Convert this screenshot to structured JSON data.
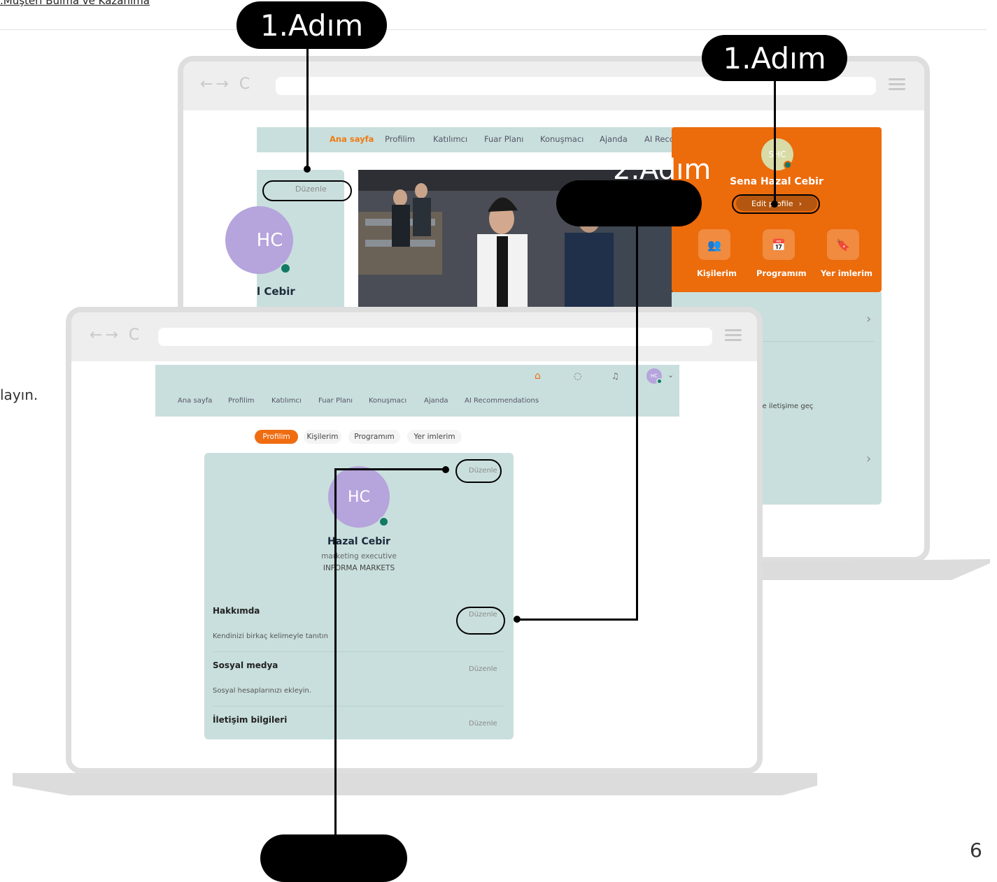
{
  "header": {
    "link_text": ".Müşteri Bulma ve Kazanıma",
    "side_text": "layın.",
    "page_number": "6"
  },
  "callouts": {
    "step1_top": "1.Adım",
    "step1_right": "1.Adım",
    "step2": "2.Adım",
    "step_bottom": ""
  },
  "back_app": {
    "nav": [
      "Ana sayfa",
      "Profilim",
      "Katılımcı",
      "Fuar Planı",
      "Konuşmacı",
      "Ajanda",
      "AI Reco"
    ],
    "edit_label": "Düzenle",
    "avatar_initials": "HC",
    "name_fragment": "l Cebir",
    "profile_panel": {
      "initials": "SHC",
      "name": "Sena Hazal Cebir",
      "edit_button": "Edit profile",
      "tiles": [
        "Kişilerim",
        "Programım",
        "Yer imlerim"
      ]
    },
    "side_text": "ile iletişime geç",
    "chevron_1": "›",
    "chevron_2": "›"
  },
  "front_app": {
    "top_icons": [
      "home-icon",
      "chat-icon",
      "bell-icon"
    ],
    "avatar_initials": "HC",
    "nav": [
      "Ana sayfa",
      "Profilim",
      "Katılımcı",
      "Fuar Planı",
      "Konuşmacı",
      "Ajanda",
      "AI Recommendations"
    ],
    "pills": [
      "Profilim",
      "Kişilerim",
      "Programım",
      "Yer imlerim"
    ],
    "profile": {
      "initials": "HC",
      "name": "Hazal Cebir",
      "title": "marketing executive",
      "company": "INFORMA MARKETS",
      "edit_label": "Düzenle"
    },
    "sections": [
      {
        "title": "Hakkımda",
        "description": "Kendinizi birkaç kelimeyle tanıtın",
        "edit": "Düzenle"
      },
      {
        "title": "Sosyal medya",
        "description": "Sosyal hesaplarınızı ekleyin.",
        "edit": "Düzenle"
      },
      {
        "title": "İletişim bilgileri",
        "description": "",
        "edit": "Düzenle"
      }
    ]
  },
  "colors": {
    "accent": "#ec6b0b",
    "panel": "#c9dfdd",
    "avatar": "#b6a4dc",
    "online": "#137a64"
  }
}
